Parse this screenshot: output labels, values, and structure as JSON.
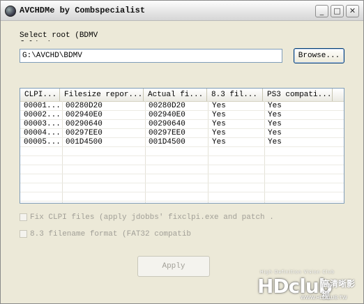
{
  "window": {
    "title": "AVCHDMe by Combspecialist",
    "min_glyph": "_",
    "max_glyph": "□",
    "close_glyph": "✕"
  },
  "form": {
    "root_label": "Select root (BDMV folder)",
    "path_value": "G:\\AVCHD\\BDMV",
    "browse_label": "Browse..."
  },
  "table": {
    "columns": [
      "CLPI...",
      "Filesize repor...",
      "Actual fi...",
      "8.3 fil...",
      "PS3 compati..."
    ],
    "rows": [
      [
        "00001...",
        "00280D20",
        "00280D20",
        "Yes",
        "Yes"
      ],
      [
        "00002...",
        "002940E0",
        "002940E0",
        "Yes",
        "Yes"
      ],
      [
        "00003...",
        "00290640",
        "00290640",
        "Yes",
        "Yes"
      ],
      [
        "00004...",
        "00297EE0",
        "00297EE0",
        "Yes",
        "Yes"
      ],
      [
        "00005...",
        "001D4500",
        "001D4500",
        "Yes",
        "Yes"
      ]
    ]
  },
  "options": {
    "fix_clpi_label": "Fix CLPI files (apply jdobbs' fixclpi.exe and patch .",
    "filename_83_label": "8.3 filename format (FAT32 compatib"
  },
  "actions": {
    "apply_label": "Apply"
  },
  "watermark": {
    "tagline": "High Definition Vision Club",
    "logo": "HDclub",
    "cjk": "高清晰影视",
    "url": "WWW.HD.CLUB.TW"
  }
}
